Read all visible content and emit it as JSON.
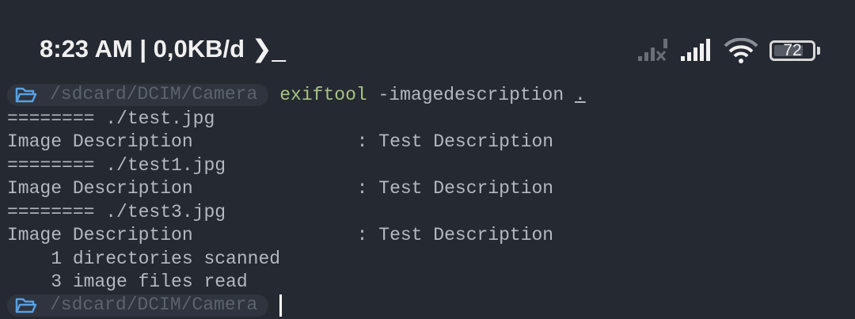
{
  "status_bar": {
    "time": "8:23 AM",
    "separator": "|",
    "data_rate": "0,0KB/d",
    "terminal_indicator": "❯_",
    "battery": "72"
  },
  "prompt": {
    "path": "/sdcard/DCIM/Camera",
    "command": "exiftool",
    "args": "-imagedescription",
    "target": "."
  },
  "output": [
    "======== ./test.jpg",
    "Image Description               : Test Description",
    "======== ./test1.jpg",
    "Image Description               : Test Description",
    "======== ./test3.jpg",
    "Image Description               : Test Description",
    "    1 directories scanned",
    "    3 image files read"
  ],
  "next_prompt": {
    "path": "/sdcard/DCIM/Camera"
  }
}
